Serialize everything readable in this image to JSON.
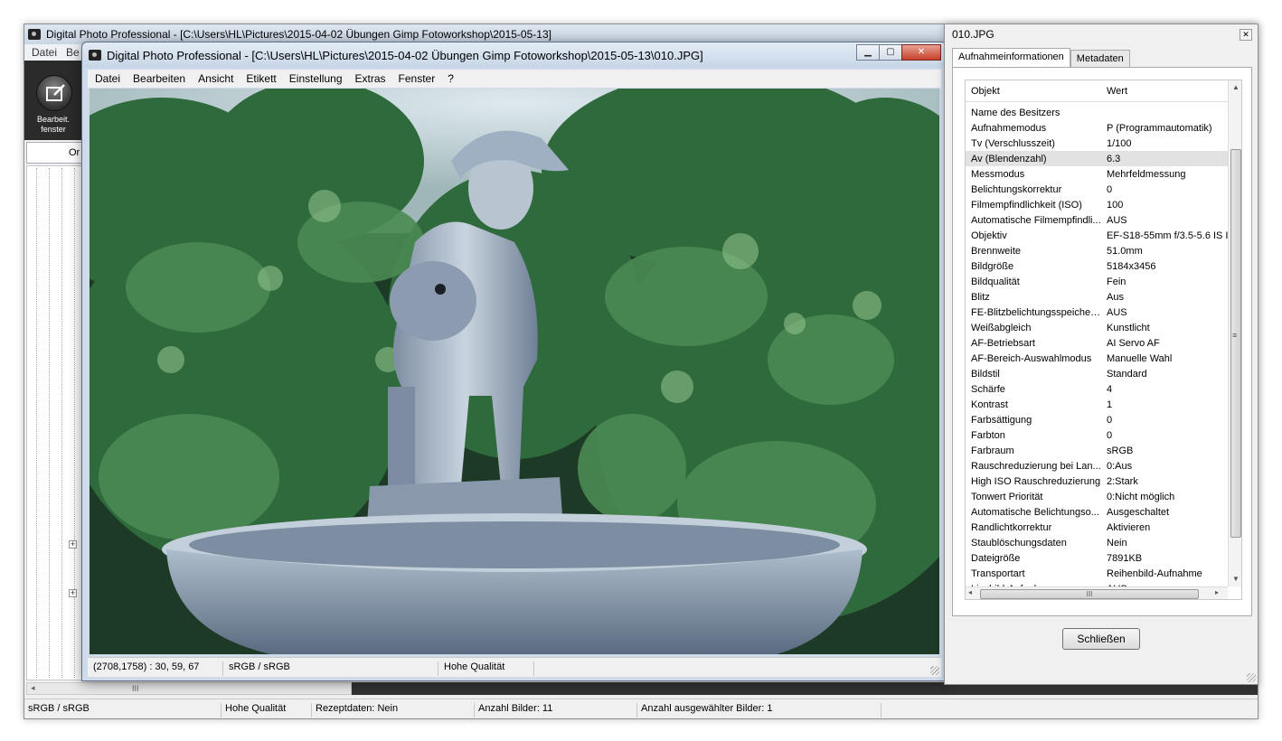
{
  "main_window": {
    "title": "Digital Photo Professional - [C:\\Users\\HL\\Pictures\\2015-04-02 Übungen  Gimp Fotoworkshop\\2015-05-13]",
    "menu": [
      "Datei",
      "Be"
    ],
    "toolbar_edit_label_line1": "Bearbeit.",
    "toolbar_edit_label_line2": "fenster",
    "sort_label": "Or",
    "hscroll_glyph": "III",
    "status": {
      "color_space": "sRGB / sRGB",
      "quality": "Hohe Qualität",
      "recipe": "Rezeptdaten: Nein",
      "image_count": "Anzahl Bilder: 11",
      "selected_count": "Anzahl ausgewählter Bilder: 1"
    }
  },
  "edit_window": {
    "title": "Digital Photo Professional - [C:\\Users\\HL\\Pictures\\2015-04-02 Übungen  Gimp Fotoworkshop\\2015-05-13\\010.JPG]",
    "menu": [
      "Datei",
      "Bearbeiten",
      "Ansicht",
      "Etikett",
      "Einstellung",
      "Extras",
      "Fenster",
      "?"
    ],
    "status": {
      "pixel_info": "(2708,1758) :  30, 59, 67",
      "color_space": "sRGB / sRGB",
      "quality": "Hohe Qualität"
    }
  },
  "info_dialog": {
    "title": "010.JPG",
    "close_glyph": "✕",
    "tabs": [
      "Aufnahmeinformationen",
      "Metadaten"
    ],
    "active_tab": 0,
    "columns": [
      "Objekt",
      "Wert"
    ],
    "selected_row": 3,
    "rows": [
      {
        "key": "Name des Besitzers",
        "value": ""
      },
      {
        "key": "Aufnahmemodus",
        "value": "P (Programmautomatik)"
      },
      {
        "key": "Tv (Verschlusszeit)",
        "value": "1/100"
      },
      {
        "key": "Av (Blendenzahl)",
        "value": "6.3"
      },
      {
        "key": "Messmodus",
        "value": "Mehrfeldmessung"
      },
      {
        "key": "Belichtungskorrektur",
        "value": "0"
      },
      {
        "key": "Filmempfindlichkeit (ISO)",
        "value": "100"
      },
      {
        "key": "Automatische Filmempfindli...",
        "value": "AUS"
      },
      {
        "key": "Objektiv",
        "value": "EF-S18-55mm f/3.5-5.6 IS I"
      },
      {
        "key": "Brennweite",
        "value": "51.0mm"
      },
      {
        "key": "Bildgröße",
        "value": "5184x3456"
      },
      {
        "key": "Bildqualität",
        "value": "Fein"
      },
      {
        "key": "Blitz",
        "value": "Aus"
      },
      {
        "key": "FE-Blitzbelichtungsspeicher...",
        "value": "AUS"
      },
      {
        "key": "Weißabgleich",
        "value": "Kunstlicht"
      },
      {
        "key": "AF-Betriebsart",
        "value": "AI Servo AF"
      },
      {
        "key": "AF-Bereich-Auswahlmodus",
        "value": "Manuelle  Wahl"
      },
      {
        "key": "Bildstil",
        "value": "Standard"
      },
      {
        "key": "Schärfe",
        "value": "4"
      },
      {
        "key": "Kontrast",
        "value": "1"
      },
      {
        "key": "Farbsättigung",
        "value": "0"
      },
      {
        "key": "Farbton",
        "value": "0"
      },
      {
        "key": "Farbraum",
        "value": "sRGB"
      },
      {
        "key": "Rauschreduzierung bei Lan...",
        "value": "0:Aus"
      },
      {
        "key": "High ISO Rauschreduzierung",
        "value": "2:Stark"
      },
      {
        "key": "Tonwert Priorität",
        "value": "0:Nicht möglich"
      },
      {
        "key": "Automatische Belichtungso...",
        "value": "Ausgeschaltet"
      },
      {
        "key": "Randlichtkorrektur",
        "value": "Aktivieren"
      },
      {
        "key": "Staublöschungsdaten",
        "value": "Nein"
      },
      {
        "key": "Dateigröße",
        "value": "7891KB"
      },
      {
        "key": "Transportart",
        "value": "Reihenbild-Aufnahme"
      },
      {
        "key": "Livebild-Aufnahme",
        "value": "AUS"
      }
    ],
    "hscroll_glyph": "III",
    "vscroll_glyph": "≡",
    "close_button": "Schließen"
  }
}
